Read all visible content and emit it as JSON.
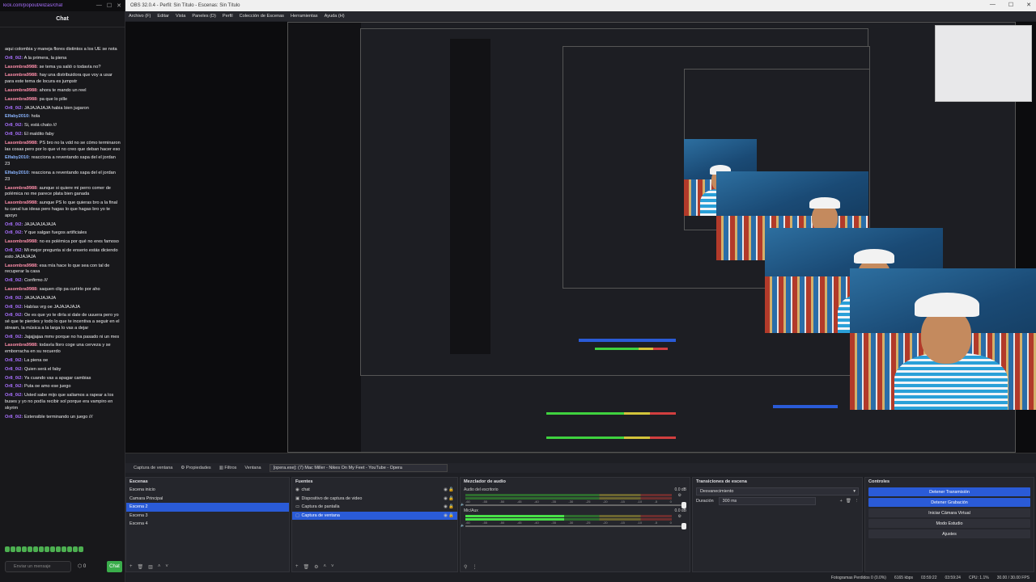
{
  "chat": {
    "url": "kick.com/popout/elizas/chat",
    "title": "Chat",
    "messages": [
      {
        "user": "",
        "text": "aqui colombia y maneja flores distintos a los UE se nota"
      },
      {
        "user": "Or8_0i2:",
        "text": "A la primera, la piena"
      },
      {
        "user": "Lasombra9988:",
        "text": "se tema ya salió o todavía no?"
      },
      {
        "user": "Lasombra9988:",
        "text": "hay una distribuidora que voy a usar para este tema de locura es jumpstr"
      },
      {
        "user": "Lasombra9988:",
        "text": "ahora te mando un reel"
      },
      {
        "user": "Lasombra9988:",
        "text": "pa que lo pille"
      },
      {
        "user": "Or8_0i2:",
        "text": "JAJAJAJAJA habia bien jugaron"
      },
      {
        "user": "Elfaby2010:",
        "text": "hola"
      },
      {
        "user": "Or8_0i2:",
        "text": "Si, está chato /// "
      },
      {
        "user": "Or8_0i2:",
        "text": "El maldito faby"
      },
      {
        "user": "Lasombra9988:",
        "text": "PS bro no la vdd no se cómo terminaron las cosas pero por lo que vi no creo que deban hacer eso"
      },
      {
        "user": "Elfaby2010:",
        "text": "reacciona a reventando xapa del el jordan 23"
      },
      {
        "user": "Elfaby2010:",
        "text": "reacciona a reventando xapa del el jordan 23"
      },
      {
        "user": "Lasombra9988:",
        "text": "aunque si quiere mi perro comer de polémica no me parece plata bien ganada"
      },
      {
        "user": "Lasombra9988:",
        "text": "aunque PS lo que quieras bro a la final tu canal tus ideas pero hagas lo que hagas bro yo te apoyo"
      },
      {
        "user": "Or8_0i2:",
        "text": "JAJAJAJAJAJA"
      },
      {
        "user": "Or8_0i2:",
        "text": "Y que salgan fuegos artificiales"
      },
      {
        "user": "Lasombra9988:",
        "text": "no es polémica por qué no eres famoso"
      },
      {
        "user": "Or8_0i2:",
        "text": "Mi mejor pregunta si de enserio estás diciendo esto JAJAJAJA"
      },
      {
        "user": "Lasombra9988:",
        "text": "esa mía hace lo que sea con tal de recuperar la casa"
      },
      {
        "user": "Or8_0i2:",
        "text": "Confirmo ///"
      },
      {
        "user": "Lasombra9988:",
        "text": "saquen clip pa curtirlo por aho"
      },
      {
        "user": "Or8_0i2:",
        "text": "JAJAJAJAJAJA"
      },
      {
        "user": "Or8_0i2:",
        "text": "Habías vrg oe JAJAJAJAJA"
      },
      {
        "user": "Or8_0i2:",
        "text": "Oe es que yo te diría si dale de uuuera pero yo sé que te pierdes y todo lo que te incentiva a seguir en el stream, la música a la larga lo vas a dejar"
      },
      {
        "user": "Or8_0i2:",
        "text": "Jajajjajaa mmv porque no ha pasado ni un mes"
      },
      {
        "user": "Lasombra9988:",
        "text": "todavía lloro coge una cerveza y se emborracha en su recuerdo"
      },
      {
        "user": "Or8_0i2:",
        "text": "La piena oe"
      },
      {
        "user": "Or8_0i2:",
        "text": "Quien será el faby"
      },
      {
        "user": "Or8_0i2:",
        "text": "Ya cuando vas a apagar cambias"
      },
      {
        "user": "Or8_0i2:",
        "text": "Puta oe amo ese juego"
      },
      {
        "user": "Or8_0i2:",
        "text": "Usted sabe mijo que saliamos a rapear a los buses y yo no podía recibir sol porque era vampiro en skyrim"
      },
      {
        "user": "Or8_0i2:",
        "text": "Extensible terminando un juego ///"
      }
    ],
    "input_placeholder": "Enviar un mensaje",
    "points": "0",
    "send_label": "Chat"
  },
  "obs": {
    "window_title": "OBS 32.0.4 - Perfil: Sin Título - Escenas: Sin Título",
    "menu": [
      "Archivo (F)",
      "Editar",
      "Vista",
      "Paneles (D)",
      "Perfil",
      "Colección de Escenas",
      "Herramientas",
      "Ayuda (H)"
    ],
    "source_bar": {
      "selected_source": "Captura de ventana",
      "properties": "Propiedades",
      "filters": "Filtros",
      "window_label": "Ventana",
      "window_value": "[opera.exe]: (7) Mac Miller - Nikes On My Feet - YouTube - Opera"
    },
    "scenes": {
      "title": "Escenas",
      "items": [
        "Escena inicio",
        "Camara Principal",
        "Escena 2",
        "Escena 3",
        "Escena 4"
      ],
      "selected_index": 2
    },
    "sources": {
      "title": "Fuentes",
      "items": [
        "chat",
        "Dispositivo de captura de video",
        "Captura de pantalla",
        "Captura de ventana"
      ],
      "selected_index": 3
    },
    "mixer": {
      "title": "Mezclador de audio",
      "channels": [
        {
          "name": "Audio del escritorio",
          "db": "0.0 dB",
          "level": 0.0
        },
        {
          "name": "Mic/Aux",
          "db": "0.0 dB",
          "level": 0.48
        }
      ],
      "scale": [
        "-60",
        "-55",
        "-50",
        "-45",
        "-40",
        "-35",
        "-30",
        "-25",
        "-20",
        "-15",
        "-10",
        "-5",
        "0"
      ]
    },
    "transitions": {
      "title": "Transiciones de escena",
      "type": "Desvanecimiento",
      "duration_label": "Duración",
      "duration_value": "300 ms"
    },
    "controls": {
      "title": "Controles",
      "buttons": [
        {
          "label": "Detener Transmisión",
          "active": true
        },
        {
          "label": "Detener Grabación",
          "active": true
        },
        {
          "label": "Iniciar Cámara Virtual",
          "active": false
        },
        {
          "label": "Modo Estudio",
          "active": false
        },
        {
          "label": "Ajustes",
          "active": false
        }
      ]
    },
    "status": {
      "dropped": "Fotogramas Perdidos 0 (0.0%)",
      "bitrate": "6165 kbps",
      "stream_time": "03:59:22",
      "rec_time": "03:59:24",
      "cpu": "CPU: 1.1%",
      "fps": "30.00 / 30.00 FPS"
    },
    "zoom": "100%",
    "theme": {
      "accent": "#2a5bd7",
      "green": "#3aad4b",
      "purple": "#a970ff"
    }
  }
}
